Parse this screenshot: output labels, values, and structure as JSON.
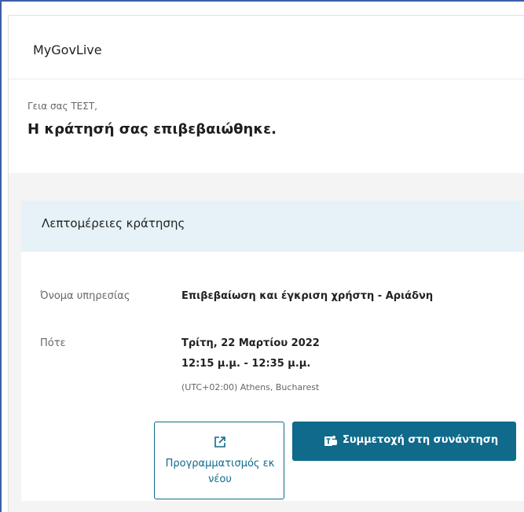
{
  "header": {
    "brand": "MyGovLive"
  },
  "greeting": {
    "salutation": "Γεια σας ΤΕΣΤ,",
    "confirmation": "Η κράτησή σας επιβεβαιώθηκε."
  },
  "details": {
    "title": "Λεπτομέρειες κράτησης",
    "service": {
      "label": "Όνομα υπηρεσίας",
      "value": "Επιβεβαίωση και έγκριση χρήστη - Αριάδνη"
    },
    "when": {
      "label": "Πότε",
      "date": "Τρίτη, 22 Μαρτίου 2022",
      "time": "12:15 μ.μ. - 12:35 μ.μ.",
      "timezone": "(UTC+02:00) Athens, Bucharest"
    }
  },
  "actions": {
    "reschedule_label": "Προγραμματισμός εκ νέου",
    "reschedule_icon": "external-link-icon",
    "join_label": "Συμμετοχή στη συνάντηση",
    "join_icon": "teams-icon"
  },
  "colors": {
    "accent": "#0f6a8b",
    "header_bg": "#e6f2f7",
    "frame_border": "#3b5fa8"
  }
}
